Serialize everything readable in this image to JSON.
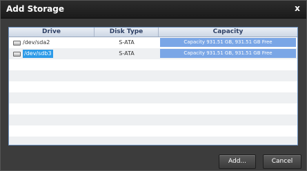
{
  "window": {
    "title": "Add Storage",
    "close_glyph": "x"
  },
  "table": {
    "columns": [
      "Drive",
      "Disk Type",
      "Capacity"
    ],
    "rows": [
      {
        "drive": "/dev/sda2",
        "disk_type": "S-ATA",
        "capacity": "Capacity 931.51 GB, 931.51 GB Free",
        "selected": false,
        "icon": "hard-drive-icon"
      },
      {
        "drive": "/dev/sdb3",
        "disk_type": "S-ATA",
        "capacity": "Capacity 931.51 GB, 931.51 GB Free",
        "selected": true,
        "icon": "hard-drive-icon"
      }
    ]
  },
  "buttons": {
    "add": "Add...",
    "cancel": "Cancel"
  },
  "colors": {
    "selection": "#2d9be8",
    "capacity_bar": "#7aa6e6",
    "dialog_bg": "#3c3c3c"
  }
}
